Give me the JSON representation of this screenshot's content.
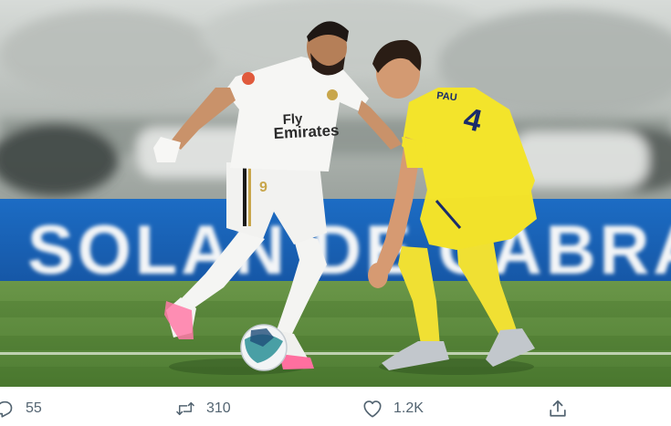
{
  "photo": {
    "alt_subject": "football-match-photo",
    "board_text": "SOLAN DE CABRA",
    "player_left": {
      "shirt_sponsor": "Fly\nEmirates",
      "shirt_number": "9"
    },
    "player_right": {
      "shirt_name": "PAU",
      "shirt_number": "4"
    }
  },
  "actions": {
    "reply_count": "55",
    "retweet_count": "310",
    "like_count": "1.2K"
  },
  "colors": {
    "pitch": "#5d8a3c",
    "board_blue": "#1a62b8",
    "yellow_kit": "#f2e22a",
    "white_kit": "#f4f4f2",
    "icon_gray": "#536471"
  }
}
